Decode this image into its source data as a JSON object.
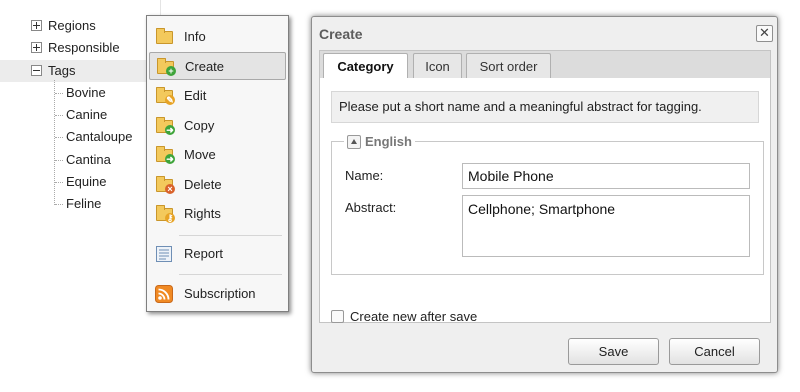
{
  "tree": {
    "roots": [
      {
        "label": "Regions",
        "expanded": false
      },
      {
        "label": "Responsible",
        "expanded": false
      },
      {
        "label": "Tags",
        "expanded": true,
        "selected": true
      }
    ],
    "children": [
      "Bovine",
      "Canine",
      "Cantaloupe",
      "Cantina",
      "Equine",
      "Feline"
    ]
  },
  "context_menu": {
    "items": [
      {
        "label": "Info",
        "icon": "folder-icon"
      },
      {
        "label": "Create",
        "icon": "folder-add-icon",
        "active": true
      },
      {
        "label": "Edit",
        "icon": "folder-edit-icon"
      },
      {
        "label": "Copy",
        "icon": "folder-copy-icon"
      },
      {
        "label": "Move",
        "icon": "folder-move-icon"
      },
      {
        "label": "Delete",
        "icon": "folder-delete-icon"
      },
      {
        "label": "Rights",
        "icon": "folder-rights-icon"
      },
      {
        "label": "Report",
        "icon": "report-icon"
      },
      {
        "label": "Subscription",
        "icon": "rss-icon"
      }
    ]
  },
  "dialog": {
    "title": "Create",
    "close_symbol": "✕",
    "tabs": [
      {
        "label": "Category",
        "active": true
      },
      {
        "label": "Icon"
      },
      {
        "label": "Sort order"
      }
    ],
    "info_text": "Please put a short name and a meaningful abstract for tagging.",
    "section_title": "English",
    "name_label": "Name:",
    "name_value": "Mobile Phone",
    "abstract_label": "Abstract:",
    "abstract_value": "Cellphone; Smartphone",
    "create_new_label": "Create new after save",
    "create_new_checked": false,
    "save_label": "Save",
    "cancel_label": "Cancel"
  },
  "colors": {
    "folder": "#f3c95c",
    "add_badge": "#3ea43a",
    "delete_badge": "#d9622b",
    "rss": "#f08a24"
  }
}
